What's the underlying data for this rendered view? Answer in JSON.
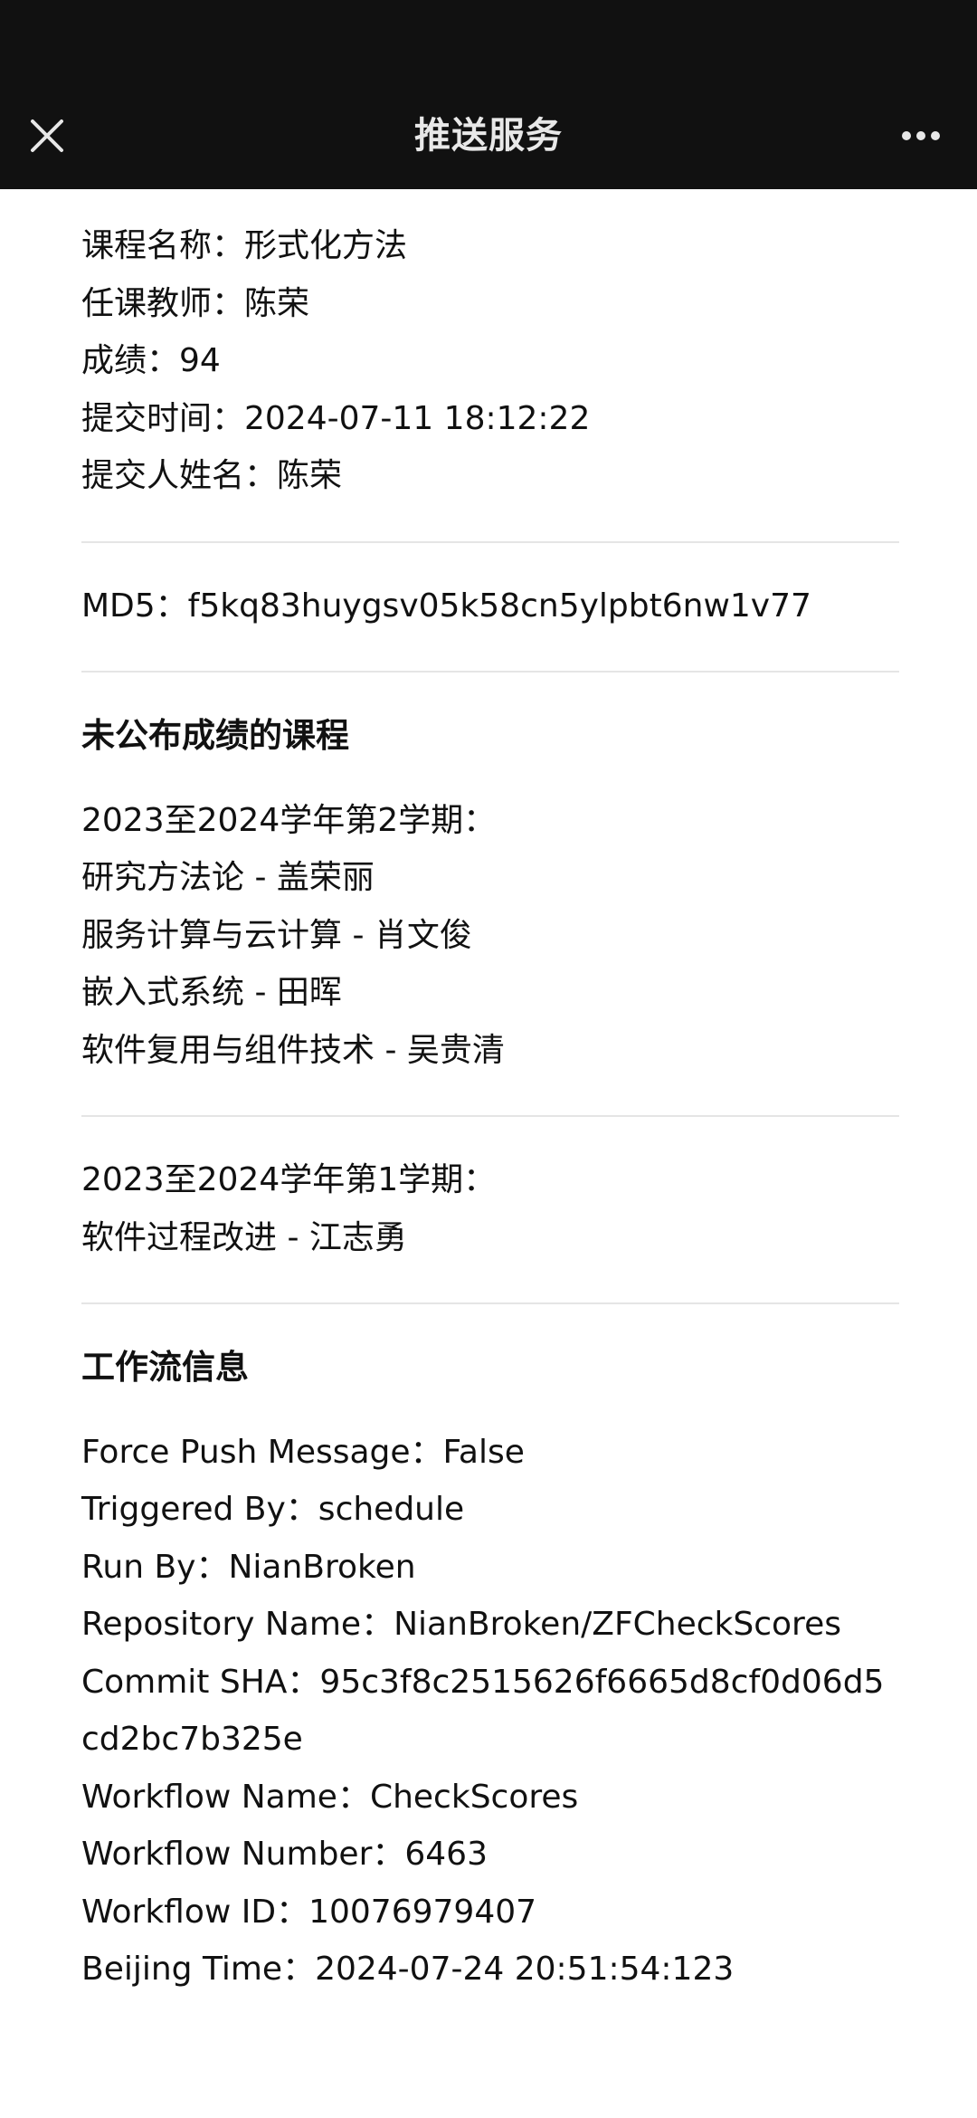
{
  "topbar": {
    "title": "推送服务",
    "close_icon": "close-icon",
    "more_icon": "more-dots-icon"
  },
  "grade_info": {
    "course_name": "课程名称：形式化方法",
    "teacher": "任课教师：陈荣",
    "score": "成绩：94",
    "submit_time": "提交时间：2024-07-11 18:12:22",
    "submitter": "提交人姓名：陈荣"
  },
  "md5": "MD5：f5kq83huygsv05k58cn5ylpbt6nw1v77",
  "unpublished": {
    "heading": "未公布成绩的课程",
    "terms": [
      {
        "term": "2023至2024学年第2学期：",
        "courses": [
          "研究方法论 - 盖荣丽",
          "服务计算与云计算 - 肖文俊",
          "嵌入式系统 - 田晖",
          "软件复用与组件技术 - 吴贵清"
        ]
      },
      {
        "term": "2023至2024学年第1学期：",
        "courses": [
          "软件过程改进 - 江志勇"
        ]
      }
    ]
  },
  "workflow": {
    "heading": "工作流信息",
    "force_push": "Force Push Message：False",
    "triggered_by": "Triggered By：schedule",
    "run_by": "Run By：NianBroken",
    "repo_name": "Repository Name：NianBroken/ZFCheckScores",
    "commit_sha": "Commit SHA：95c3f8c2515626f6665d8cf0d06d5cd2bc7b325e",
    "workflow_name": "Workflow Name：CheckScores",
    "workflow_number": "Workflow Number：6463",
    "workflow_id": "Workflow ID：10076979407",
    "beijing_time": "Beijing Time：2024-07-24 20:51:54:123"
  },
  "colors": {
    "topbar_bg": "#111111",
    "divider": "#e5e5e5"
  }
}
